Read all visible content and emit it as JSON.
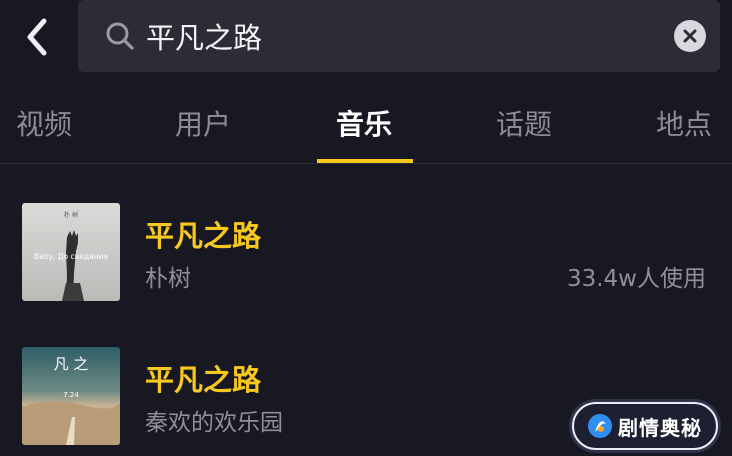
{
  "search": {
    "query": "平凡之路"
  },
  "tabs": [
    {
      "label": "视频"
    },
    {
      "label": "用户"
    },
    {
      "label": "音乐"
    },
    {
      "label": "话题"
    },
    {
      "label": "地点"
    }
  ],
  "active_tab": "音乐",
  "results": [
    {
      "title": "平凡之路",
      "artist": "朴树",
      "uses": "33.4w人使用",
      "cover_text_top": "朴 树",
      "cover_text_main": "Baby, До свидания"
    },
    {
      "title": "平凡之路",
      "artist": "秦欢的欢乐园",
      "uses": "",
      "cover_text_main": "凡 之",
      "cover_text_date": "7.24"
    }
  ],
  "watermark": {
    "text": "剧情奥秘"
  },
  "colors": {
    "background": "#181822",
    "accent": "#f7c81e",
    "search_bg": "#2c2c36",
    "muted_text": "#8f8f9a"
  }
}
